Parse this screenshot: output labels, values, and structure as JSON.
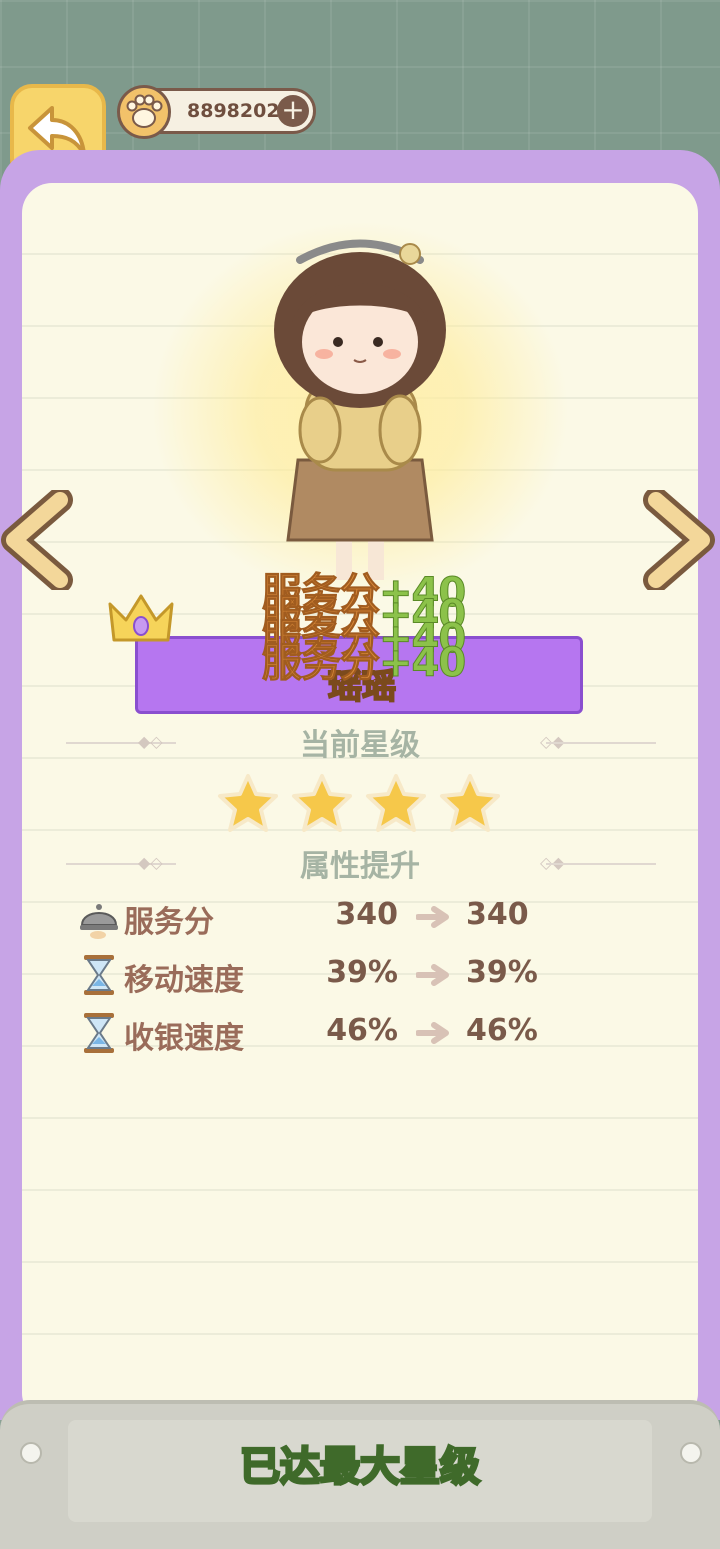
{
  "header": {
    "coins": "8898202",
    "back_icon": "back-arrow-icon",
    "add_icon": "plus-icon",
    "coin_icon": "paw-coin-icon"
  },
  "character": {
    "name": "瑶瑶",
    "floating_bonus": [
      {
        "label": "服务分",
        "value": "+40"
      },
      {
        "label": "服务分",
        "value": "+40"
      },
      {
        "label": "服务分",
        "value": "+40"
      },
      {
        "label": "服务分",
        "value": "+40"
      }
    ]
  },
  "sections": {
    "current_star": "当前星级",
    "attribute_up": "属性提升"
  },
  "stars": {
    "filled": 4,
    "total": 4
  },
  "attributes": [
    {
      "name": "服务分",
      "from": "340",
      "to": "340",
      "icon": "cloche-icon"
    },
    {
      "name": "移动速度",
      "from": "39%",
      "to": "39%",
      "icon": "hourglass-icon"
    },
    {
      "name": "收银速度",
      "from": "46%",
      "to": "46%",
      "icon": "hourglass-icon"
    }
  ],
  "footer": {
    "max_label": "已达最大星级"
  },
  "colors": {
    "panel_purple": "#c7a4e6",
    "banner_purple": "#b676f0",
    "paper": "#fbf9e6",
    "star_gold": "#f6c84a",
    "green_text": "#c5f07a"
  }
}
